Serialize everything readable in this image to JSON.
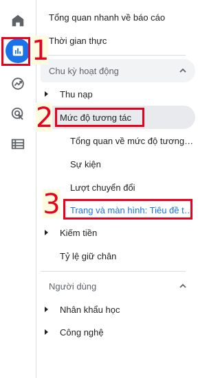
{
  "nav": {
    "items": [
      {
        "label": "Tổng quan nhanh về báo cáo"
      },
      {
        "label": "Thời gian thực"
      }
    ]
  },
  "sections": [
    {
      "title": "Chu kỳ hoạt động",
      "groups": [
        {
          "label": "Thu nạp"
        },
        {
          "label": "Mức độ tương tác",
          "children": [
            {
              "label": "Tổng quan về mức độ tương tác"
            },
            {
              "label": "Sự kiện"
            },
            {
              "label": "Lượt chuyển đổi"
            },
            {
              "label": "Trang và màn hình: Tiêu đề trang và lớp màn hình"
            }
          ]
        },
        {
          "label": "Kiếm tiền"
        },
        {
          "label": "Tỷ lệ giữ chân"
        }
      ]
    },
    {
      "title": "Người dùng",
      "groups": [
        {
          "label": "Nhân khẩu học"
        },
        {
          "label": "Công nghệ"
        }
      ]
    }
  ],
  "annotations": [
    {
      "number": "1"
    },
    {
      "number": "2"
    },
    {
      "number": "3"
    }
  ],
  "colors": {
    "accent": "#1a73e8",
    "annotation": "#e8001c",
    "annotation_bg": "#fdfbe0"
  },
  "icons": [
    "home-icon",
    "reports-icon",
    "explore-icon",
    "advertising-icon",
    "configure-icon",
    "chevron-up-icon",
    "caret-right-icon"
  ]
}
